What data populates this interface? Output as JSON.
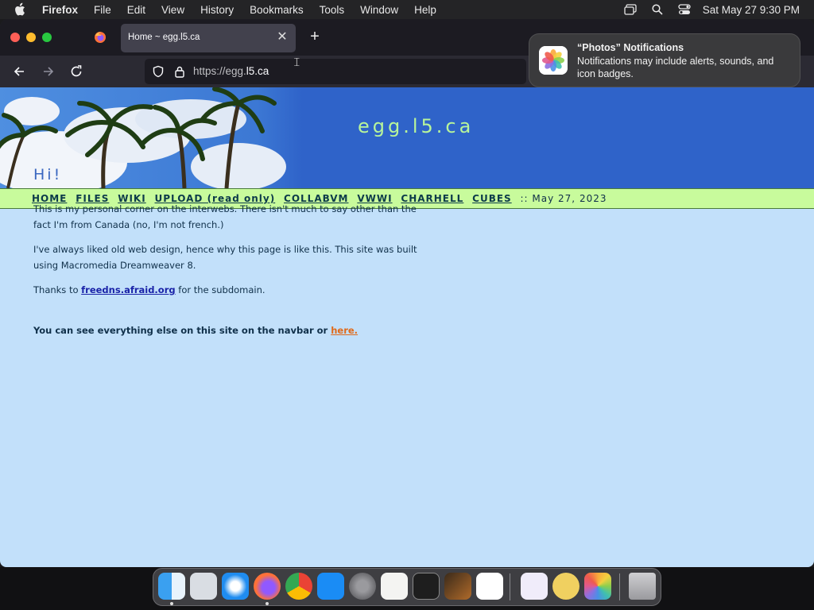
{
  "menubar": {
    "app_name": "Firefox",
    "menus": [
      "File",
      "Edit",
      "View",
      "History",
      "Bookmarks",
      "Tools",
      "Window",
      "Help"
    ],
    "clock": "Sat May 27  9:30 PM"
  },
  "browser": {
    "tab_title": "Home ~ egg.l5.ca",
    "url_prefix": "https://egg.",
    "url_domain": "l5.ca"
  },
  "notification": {
    "title": "“Photos” Notifications",
    "body": "Notifications may include alerts, sounds, and icon badges."
  },
  "site": {
    "title": "egg.l5.ca",
    "nav": [
      "HOME",
      "FILES",
      "WIKI",
      "UPLOAD (read only)",
      "COLLABVM",
      "VWWI",
      "CHARHELL",
      "CUBES"
    ],
    "date": ":: May 27, 2023",
    "heading": "Hi!",
    "p1": "This is my personal corner on the interwebs. There isn't much to say other than the fact I'm from Canada (no, I'm not french.)",
    "p2": "I've always liked old web design, hence why this page is like this. This site was built using Macromedia Dreamweaver 8.",
    "p3_before": "Thanks to ",
    "p3_link": "freedns.afraid.org",
    "p3_after": " for the subdomain.",
    "p4_before": "You can see everything else on this site on the navbar or ",
    "p4_link": "here."
  },
  "dock": [
    "Finder",
    "Launchpad",
    "Safari",
    "Firefox",
    "Chrome",
    "App Store",
    "System Settings",
    "TextEdit",
    "Terminal",
    "GarageBand",
    "Visual Studio Code",
    "Visual Studio",
    "Cyberduck",
    "Photos",
    "Trash"
  ]
}
